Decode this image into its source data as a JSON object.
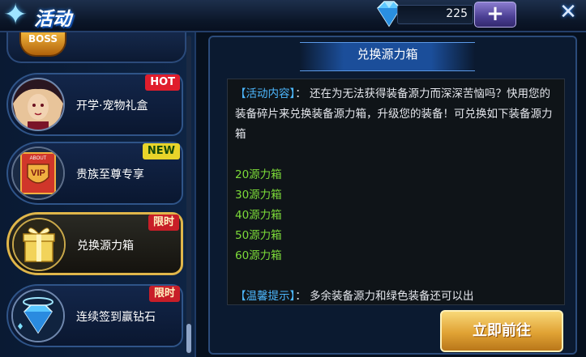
{
  "header": {
    "title": "活动",
    "gem_count": "225",
    "plus_label": "+",
    "close_label": "✕"
  },
  "sidebar": {
    "items": [
      {
        "label": "开学·宠物礼盒",
        "tag": "HOT"
      },
      {
        "label": "贵族至尊专享",
        "tag": "NEW"
      },
      {
        "label": "兑换源力箱",
        "tag": "限时"
      },
      {
        "label": "连续签到赢钻石",
        "tag": "限时"
      }
    ],
    "boss_label": "BOSS"
  },
  "detail": {
    "title": "兑换源力箱",
    "intro_tag": "【活动内容】",
    "intro_text": "：  还在为无法获得装备源力而深深苦恼吗？快用您的装备碎片来兑换装备源力箱，升级您的装备！可兑换如下装备源力箱",
    "options": [
      "20源力箱",
      "30源力箱",
      "40源力箱",
      "50源力箱",
      "60源力箱"
    ],
    "tip_tag": "【温馨提示】",
    "tip_text": "：   多余装备源力和绿色装备还可以出",
    "go_button": "立即前往"
  }
}
